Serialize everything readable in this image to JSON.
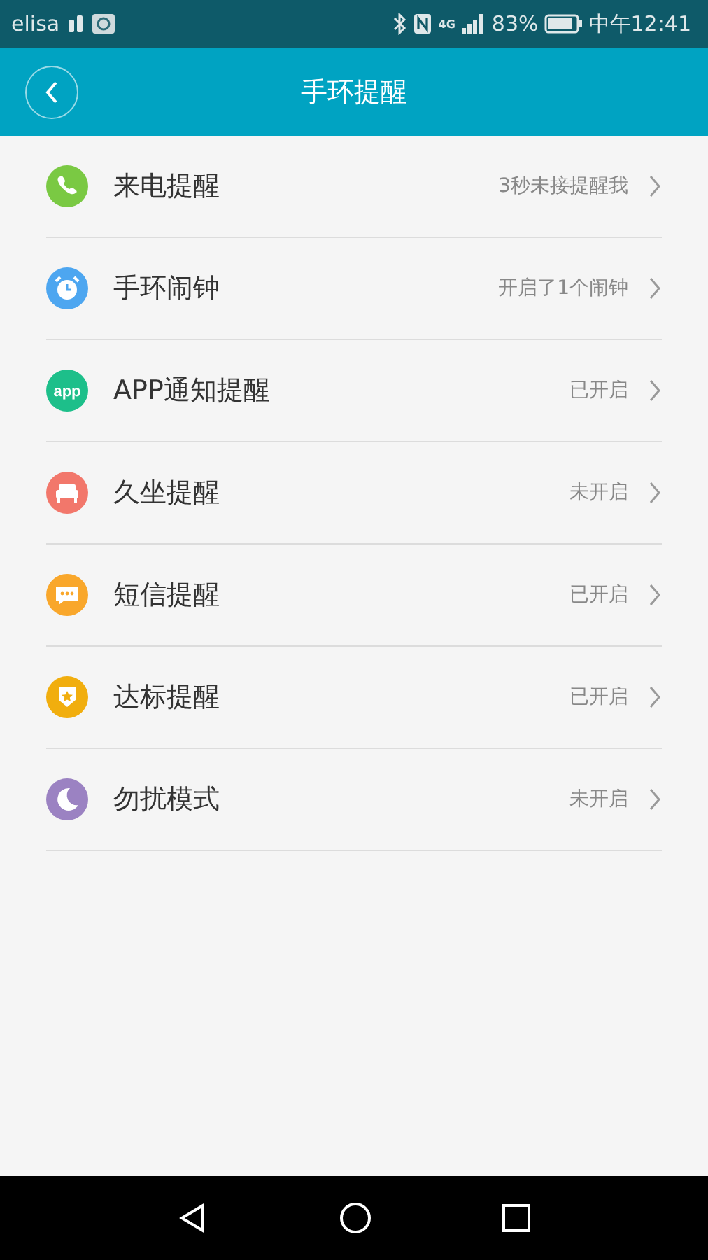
{
  "status_bar": {
    "carrier": "elisa",
    "network": "4G",
    "battery": "83%",
    "time": "中午12:41"
  },
  "header": {
    "title": "手环提醒"
  },
  "items": [
    {
      "kind": "phone",
      "color": "#7ac943",
      "label": "来电提醒",
      "value": "3秒未接提醒我"
    },
    {
      "kind": "alarm",
      "color": "#4da6f0",
      "label": "手环闹钟",
      "value": "开启了1个闹钟"
    },
    {
      "kind": "app",
      "icon_text": "app",
      "color": "#1dbf8a",
      "label": "APP通知提醒",
      "value": "已开启"
    },
    {
      "kind": "sofa",
      "color": "#f2776b",
      "label": "久坐提醒",
      "value": "未开启"
    },
    {
      "kind": "message",
      "color": "#f9a72b",
      "label": "短信提醒",
      "value": "已开启"
    },
    {
      "kind": "badge",
      "color": "#f1ae0e",
      "label": "达标提醒",
      "value": "已开启"
    },
    {
      "kind": "moon",
      "color": "#9b82c2",
      "label": "勿扰模式",
      "value": "未开启"
    }
  ]
}
